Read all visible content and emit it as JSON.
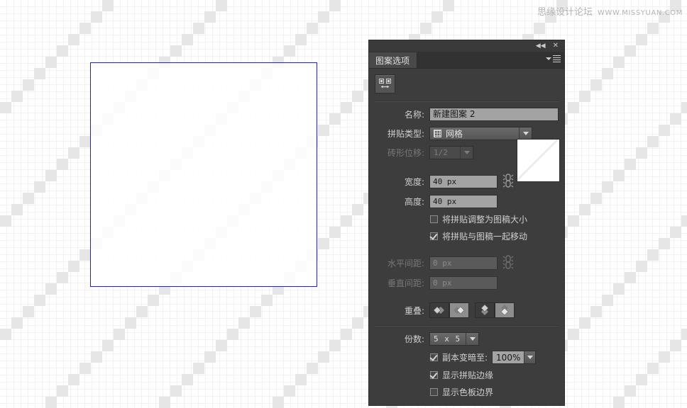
{
  "watermark": {
    "text_cn": "思缘设计论坛",
    "url": "WWW.MISSYUAN.COM"
  },
  "canvas": {
    "name": "pattern-artboard",
    "tile_border_color": "#2222cc",
    "grid_color": "#f2f2f2",
    "pattern_square_color": "#e6e6e6"
  },
  "panel": {
    "titlebar": {
      "collapse_icon": "◀◀",
      "close_icon": "✕"
    },
    "tab_label": "图案选项",
    "tool_button_name": "pattern-tile-tool",
    "fields": {
      "name_label": "名称:",
      "name_value": "新建图案 2",
      "tile_type_label": "拼贴类型:",
      "tile_type_value": "网格",
      "brick_offset_label": "砖形位移:",
      "brick_offset_value": "1/2",
      "width_label": "宽度:",
      "width_value": "40 px",
      "height_label": "高度:",
      "height_value": "40 px",
      "h_spacing_label": "水平间距:",
      "h_spacing_value": "0 px",
      "v_spacing_label": "垂直间距:",
      "v_spacing_value": "0 px",
      "overlap_label": "重叠:",
      "copies_label": "份数:",
      "copies_value": "5 x 5",
      "dim_copies_label": "副本变暗至:",
      "dim_copies_value": "100%"
    },
    "checkboxes": [
      {
        "label": "将拼贴调整为图稿大小",
        "checked": false
      },
      {
        "label": "将拼贴与图稿一起移动",
        "checked": true
      },
      {
        "label": "显示拼贴边缘",
        "checked": true
      },
      {
        "label": "显示色板边界",
        "checked": false
      }
    ],
    "overlap_buttons": [
      {
        "name": "overlap-left-in-front",
        "selected": false,
        "orientation": "horizontal"
      },
      {
        "name": "overlap-right-in-front",
        "selected": true,
        "orientation": "horizontal"
      },
      {
        "name": "overlap-top-in-front",
        "selected": false,
        "orientation": "vertical"
      },
      {
        "name": "overlap-bottom-in-front",
        "selected": true,
        "orientation": "vertical"
      }
    ],
    "colors": {
      "panel_bg": "#3d3d3d",
      "tab_active_bg": "#494949",
      "field_bg": "#a3a3a3",
      "field_disabled_bg": "#5a5a5a",
      "text": "#cfcfcf",
      "text_disabled": "#787878"
    }
  }
}
